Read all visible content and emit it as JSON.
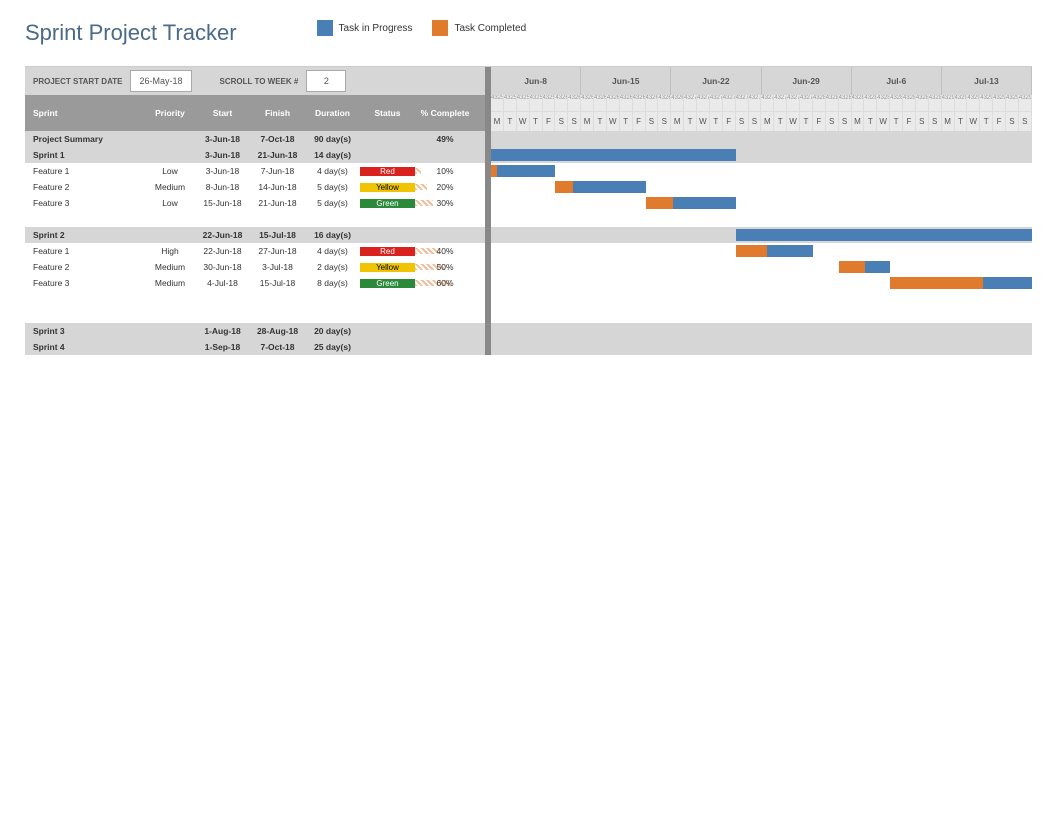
{
  "title": "Sprint Project Tracker",
  "legend": {
    "progress": "Task in Progress",
    "completed": "Task Completed"
  },
  "controls": {
    "start_date_label": "PROJECT START DATE",
    "start_date_value": "26-May-18",
    "scroll_label": "SCROLL TO WEEK #",
    "scroll_value": "2"
  },
  "columns": {
    "name": "Sprint",
    "priority": "Priority",
    "start": "Start",
    "finish": "Finish",
    "duration": "Duration",
    "status": "Status",
    "pct": "% Complete"
  },
  "timeline": {
    "weeks": [
      "Jun-8",
      "Jun-15",
      "Jun-22",
      "Jun-29",
      "Jul-6",
      "Jul-13"
    ],
    "day_pattern": [
      "M",
      "T",
      "W",
      "T",
      "F",
      "S",
      "S"
    ],
    "serial_start": 43255
  },
  "summary": {
    "name": "Project Summary",
    "start": "3-Jun-18",
    "finish": "7-Oct-18",
    "duration": "90 day(s)",
    "pct": "49%"
  },
  "sprints": [
    {
      "name": "Sprint 1",
      "start": "3-Jun-18",
      "finish": "21-Jun-18",
      "duration": "14 day(s)",
      "bar": {
        "offset": 0,
        "comp_len": 0,
        "prog_len": 19
      },
      "features": [
        {
          "name": "Feature 1",
          "priority": "Low",
          "start": "3-Jun-18",
          "finish": "7-Jun-18",
          "duration": "4 day(s)",
          "status": "Red",
          "status_class": "status-red",
          "pct": "10%",
          "bar": {
            "offset": 0,
            "comp_len": 0.5,
            "prog_len": 4.5
          }
        },
        {
          "name": "Feature 2",
          "priority": "Medium",
          "start": "8-Jun-18",
          "finish": "14-Jun-18",
          "duration": "5 day(s)",
          "status": "Yellow",
          "status_class": "status-yellow",
          "pct": "20%",
          "bar": {
            "offset": 5,
            "comp_len": 1.4,
            "prog_len": 5.6
          }
        },
        {
          "name": "Feature 3",
          "priority": "Low",
          "start": "15-Jun-18",
          "finish": "21-Jun-18",
          "duration": "5 day(s)",
          "status": "Green",
          "status_class": "status-green",
          "pct": "30%",
          "bar": {
            "offset": 12,
            "comp_len": 2.1,
            "prog_len": 4.9
          }
        }
      ]
    },
    {
      "name": "Sprint 2",
      "start": "22-Jun-18",
      "finish": "15-Jul-18",
      "duration": "16 day(s)",
      "bar": {
        "offset": 19,
        "comp_len": 0,
        "prog_len": 24
      },
      "features": [
        {
          "name": "Feature 1",
          "priority": "High",
          "start": "22-Jun-18",
          "finish": "27-Jun-18",
          "duration": "4 day(s)",
          "status": "Red",
          "status_class": "status-red",
          "pct": "40%",
          "bar": {
            "offset": 19,
            "comp_len": 2.4,
            "prog_len": 3.6
          }
        },
        {
          "name": "Feature 2",
          "priority": "Medium",
          "start": "30-Jun-18",
          "finish": "3-Jul-18",
          "duration": "2 day(s)",
          "status": "Yellow",
          "status_class": "status-yellow",
          "pct": "50%",
          "bar": {
            "offset": 27,
            "comp_len": 2,
            "prog_len": 2
          }
        },
        {
          "name": "Feature 3",
          "priority": "Medium",
          "start": "4-Jul-18",
          "finish": "15-Jul-18",
          "duration": "8 day(s)",
          "status": "Green",
          "status_class": "status-green",
          "pct": "60%",
          "bar": {
            "offset": 31,
            "comp_len": 7.2,
            "prog_len": 4.8
          }
        }
      ]
    },
    {
      "name": "Sprint 3",
      "start": "1-Aug-18",
      "finish": "28-Aug-18",
      "duration": "20 day(s)",
      "features": []
    },
    {
      "name": "Sprint 4",
      "start": "1-Sep-18",
      "finish": "7-Oct-18",
      "duration": "25 day(s)",
      "features": []
    }
  ],
  "chart_data": {
    "type": "gantt",
    "title": "Sprint Project Tracker",
    "timeline_start": "2018-06-04",
    "timeline_weeks": [
      "Jun-8",
      "Jun-15",
      "Jun-22",
      "Jun-29",
      "Jul-6",
      "Jul-13"
    ],
    "tasks": [
      {
        "name": "Sprint 1",
        "start": "2018-06-03",
        "finish": "2018-06-21",
        "pct_complete": null
      },
      {
        "name": "Sprint 1 / Feature 1",
        "start": "2018-06-03",
        "finish": "2018-06-07",
        "pct_complete": 10,
        "status": "Red",
        "priority": "Low"
      },
      {
        "name": "Sprint 1 / Feature 2",
        "start": "2018-06-08",
        "finish": "2018-06-14",
        "pct_complete": 20,
        "status": "Yellow",
        "priority": "Medium"
      },
      {
        "name": "Sprint 1 / Feature 3",
        "start": "2018-06-15",
        "finish": "2018-06-21",
        "pct_complete": 30,
        "status": "Green",
        "priority": "Low"
      },
      {
        "name": "Sprint 2",
        "start": "2018-06-22",
        "finish": "2018-07-15",
        "pct_complete": null
      },
      {
        "name": "Sprint 2 / Feature 1",
        "start": "2018-06-22",
        "finish": "2018-06-27",
        "pct_complete": 40,
        "status": "Red",
        "priority": "High"
      },
      {
        "name": "Sprint 2 / Feature 2",
        "start": "2018-06-30",
        "finish": "2018-07-03",
        "pct_complete": 50,
        "status": "Yellow",
        "priority": "Medium"
      },
      {
        "name": "Sprint 2 / Feature 3",
        "start": "2018-07-04",
        "finish": "2018-07-15",
        "pct_complete": 60,
        "status": "Green",
        "priority": "Medium"
      },
      {
        "name": "Sprint 3",
        "start": "2018-08-01",
        "finish": "2018-08-28",
        "pct_complete": null
      },
      {
        "name": "Sprint 4",
        "start": "2018-09-01",
        "finish": "2018-10-07",
        "pct_complete": null
      }
    ],
    "legend": [
      "Task in Progress",
      "Task Completed"
    ]
  }
}
